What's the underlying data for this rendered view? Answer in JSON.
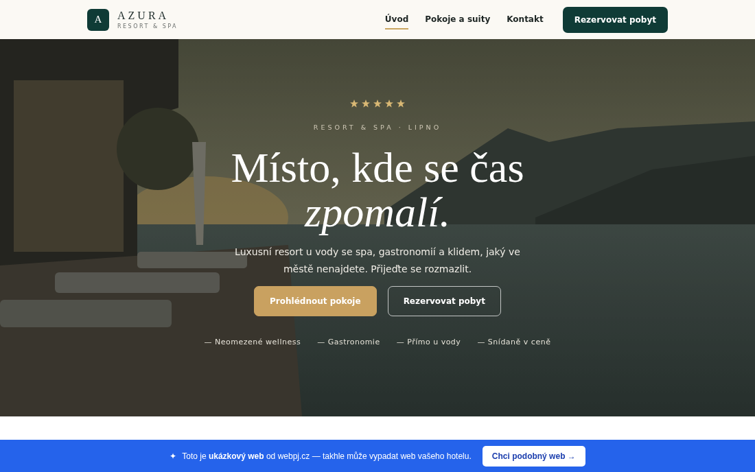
{
  "brand": {
    "logo_letter": "A",
    "name": "AZURA",
    "tagline": "RESORT & SPA"
  },
  "nav": [
    {
      "label": "Úvod",
      "selected": true
    },
    {
      "label": "Pokoje a suity",
      "selected": false
    },
    {
      "label": "Kontakt",
      "selected": false
    }
  ],
  "nav_button": "Rezervovat pobyt",
  "hero": {
    "kind": "picture",
    "stars": 5,
    "eyebrow": "RESORT & SPA · LIPNO",
    "title_line1": "Místo, kde se čas",
    "title_line2": "zpomalí.",
    "lead": "Luxusní resort u vody se spa, gastronomií a klidem, jaký ve městě nenajdete. Přijeďte se rozmazlit.",
    "buttons": [
      {
        "label": "Prohlédnout pokoje",
        "kind": "primary"
      },
      {
        "label": "Rezervovat pobyt",
        "kind": "outline"
      }
    ],
    "features": [
      "— Neomezené wellness",
      "— Gastronomie",
      "— Přímo u vody",
      "— Snídaně v ceně"
    ]
  },
  "banner": {
    "symbol": "✦",
    "text": "Toto je **ukázkový web** od webpj.cz — takhle může vypadat web vašeho hotelu.",
    "button": "Chci podobný web →"
  }
}
